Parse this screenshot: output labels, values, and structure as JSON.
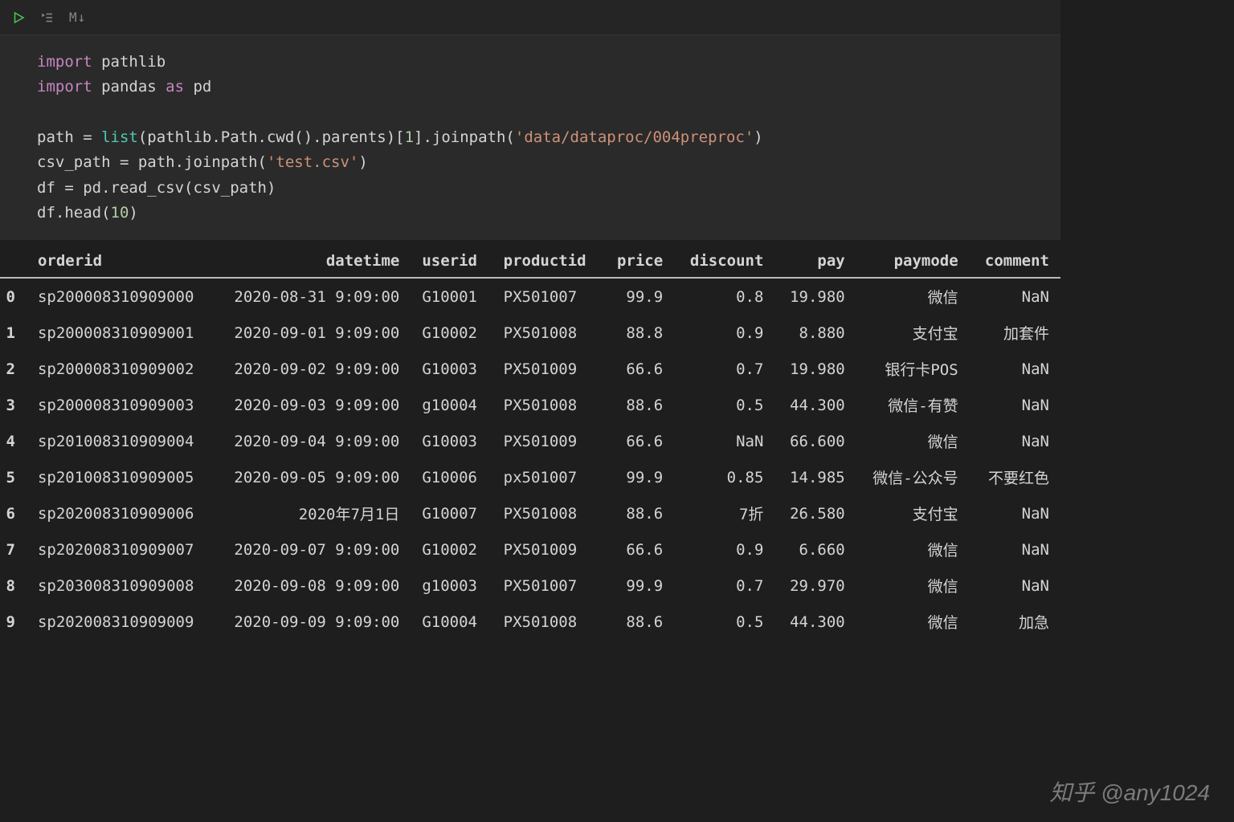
{
  "toolbar": {
    "markdown_label": "M↓"
  },
  "code": {
    "line1": {
      "kw": "import",
      "rest": " pathlib"
    },
    "line2": {
      "kw": "import",
      "mid": " pandas ",
      "as": "as",
      "alias": " pd"
    },
    "line3": {
      "var": "path = ",
      "fn": "list",
      "mid1": "(pathlib.Path.cwd().parents)[",
      "num1": "1",
      "mid2": "].joinpath(",
      "str1": "'data/dataproc/004preproc'",
      "end": ")"
    },
    "line4": {
      "var": "csv_path = path.joinpath(",
      "str1": "'test.csv'",
      "end": ")"
    },
    "line5": {
      "text": "df = pd.read_csv(csv_path)"
    },
    "line6": {
      "pre": "df.head(",
      "num": "10",
      "end": ")"
    }
  },
  "table": {
    "columns": [
      "",
      "orderid",
      "datetime",
      "userid",
      "productid",
      "price",
      "discount",
      "pay",
      "paymode",
      "comment"
    ],
    "rows": [
      [
        "0",
        "sp200008310909000",
        "2020-08-31 9:09:00",
        "G10001",
        "PX501007",
        "99.9",
        "0.8",
        "19.980",
        "微信",
        "NaN"
      ],
      [
        "1",
        "sp200008310909001",
        "2020-09-01 9:09:00",
        "G10002",
        "PX501008",
        "88.8",
        "0.9",
        "8.880",
        "支付宝",
        "加套件"
      ],
      [
        "2",
        "sp200008310909002",
        "2020-09-02 9:09:00",
        "G10003",
        "PX501009",
        "66.6",
        "0.7",
        "19.980",
        "银行卡POS",
        "NaN"
      ],
      [
        "3",
        "sp200008310909003",
        "2020-09-03 9:09:00",
        "g10004",
        "PX501008",
        "88.6",
        "0.5",
        "44.300",
        "微信-有赞",
        "NaN"
      ],
      [
        "4",
        "sp201008310909004",
        "2020-09-04 9:09:00",
        "G10003",
        "PX501009",
        "66.6",
        "NaN",
        "66.600",
        "微信",
        "NaN"
      ],
      [
        "5",
        "sp201008310909005",
        "2020-09-05 9:09:00",
        "G10006",
        "px501007",
        "99.9",
        "0.85",
        "14.985",
        "微信-公众号",
        "不要红色"
      ],
      [
        "6",
        "sp202008310909006",
        "2020年7月1日",
        "G10007",
        "PX501008",
        "88.6",
        "7折",
        "26.580",
        "支付宝",
        "NaN"
      ],
      [
        "7",
        "sp202008310909007",
        "2020-09-07 9:09:00",
        "G10002",
        "PX501009",
        "66.6",
        "0.9",
        "6.660",
        "微信",
        "NaN"
      ],
      [
        "8",
        "sp203008310909008",
        "2020-09-08 9:09:00",
        "g10003",
        "PX501007",
        "99.9",
        "0.7",
        "29.970",
        "微信",
        "NaN"
      ],
      [
        "9",
        "sp202008310909009",
        "2020-09-09 9:09:00",
        "G10004",
        "PX501008",
        "88.6",
        "0.5",
        "44.300",
        "微信",
        "加急"
      ]
    ]
  },
  "watermark": "知乎 @any1024"
}
